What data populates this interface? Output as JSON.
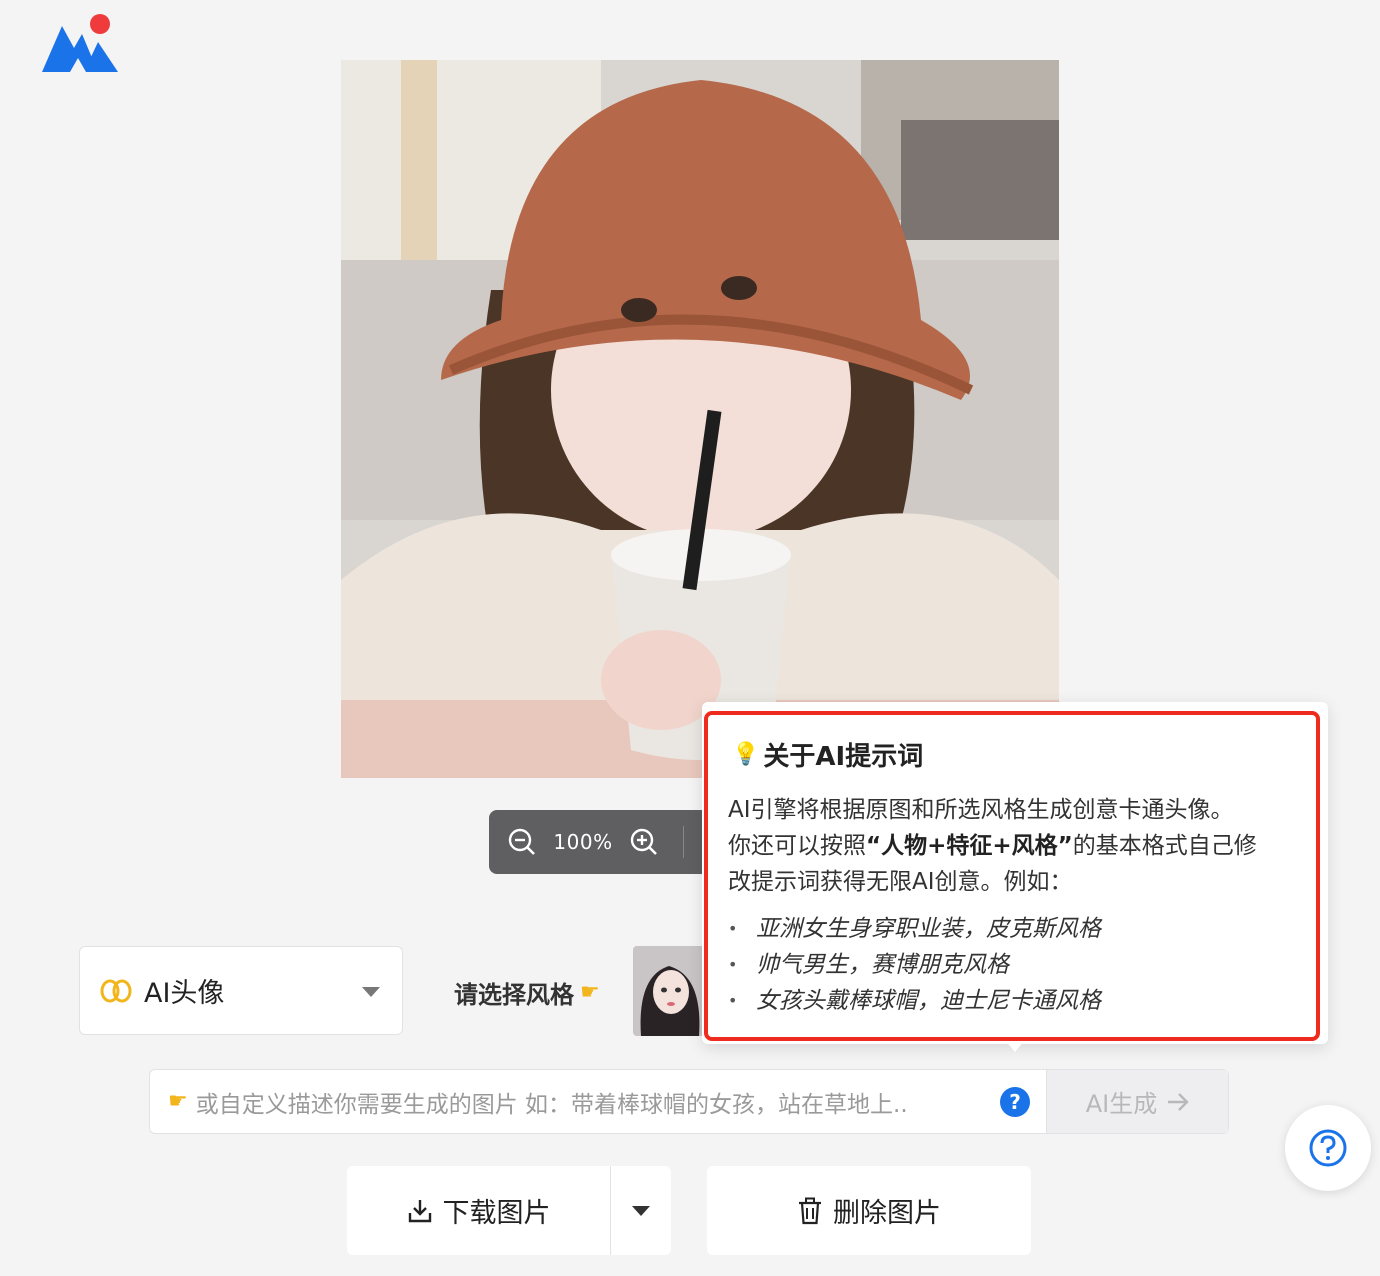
{
  "zoom": {
    "value": "100%"
  },
  "mode_select": {
    "label": "AI头像"
  },
  "style": {
    "prompt_label": "请选择风格"
  },
  "prompt": {
    "placeholder": "或自定义描述你需要生成的图片 如：带着棒球帽的女孩，站在草地上..",
    "help_label": "?",
    "generate_label": "AI生成"
  },
  "actions": {
    "download_label": "下载图片",
    "delete_label": "删除图片"
  },
  "tooltip": {
    "title": "关于AI提示词",
    "line1": "AI引擎将根据原图和所选风格生成创意卡通头像。",
    "line2_prefix": "你还可以按照",
    "line2_emph": "“人物+特征+风格”",
    "line2_suffix": "的基本格式自己修",
    "line3": "改提示词获得无限AI创意。例如：",
    "examples": [
      "亚洲女生身穿职业装，皮克斯风格",
      "帅气男生，赛博朋克风格",
      "女孩头戴棒球帽，迪士尼卡通风格"
    ]
  },
  "colors": {
    "brand_blue": "#1a73e8",
    "brand_red": "#ef3b3b",
    "highlight_border": "#ef2a1f",
    "zoom_bar_bg": "#5f5f62"
  },
  "icons": [
    "logo-icon",
    "zoom-out-icon",
    "zoom-in-icon",
    "ai-avatar-icon",
    "pointing-hand-icon",
    "lightbulb-icon",
    "question-icon",
    "arrow-right-icon",
    "download-icon",
    "trash-icon"
  ]
}
